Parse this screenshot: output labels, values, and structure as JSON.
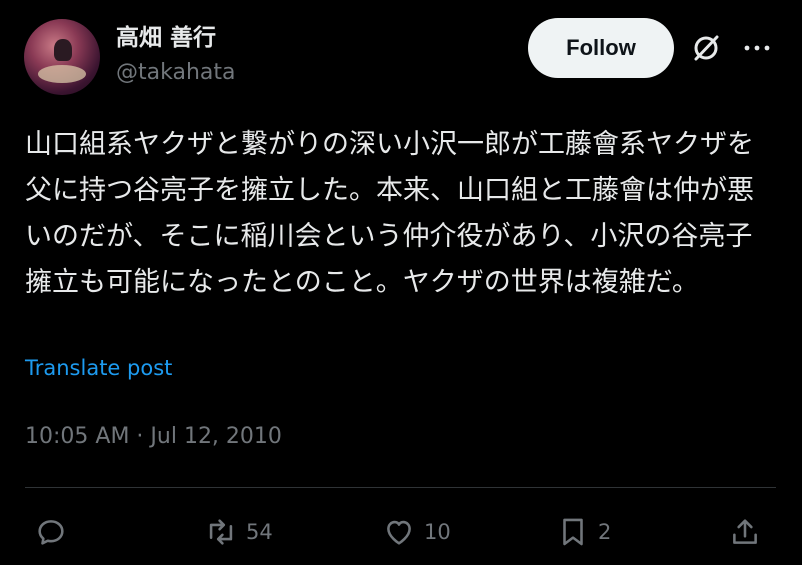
{
  "author": {
    "display_name": "高畑 善行",
    "handle": "@takahata"
  },
  "header": {
    "follow_label": "Follow"
  },
  "tweet": {
    "text": "山口組系ヤクザと繋がりの深い小沢一郎が工藤會系ヤクザを父に持つ谷亮子を擁立した。本来、山口組と工藤會は仲が悪いのだが、そこに稲川会という仲介役があり、小沢の谷亮子擁立も可能になったとのこと。ヤクザの世界は複雑だ。",
    "translate_label": "Translate post",
    "timestamp": "10:05 AM · Jul 12, 2010"
  },
  "actions": {
    "reply": {
      "icon": "reply-icon",
      "count": ""
    },
    "retweet": {
      "icon": "retweet-icon",
      "count": "54"
    },
    "like": {
      "icon": "heart-icon",
      "count": "10"
    },
    "bookmark": {
      "icon": "bookmark-icon",
      "count": "2"
    },
    "share": {
      "icon": "share-icon",
      "count": ""
    }
  },
  "colors": {
    "background": "#000000",
    "text": "#e7e9ea",
    "muted": "#71767b",
    "link": "#1d9bf0",
    "follow_bg": "#eff3f4"
  }
}
